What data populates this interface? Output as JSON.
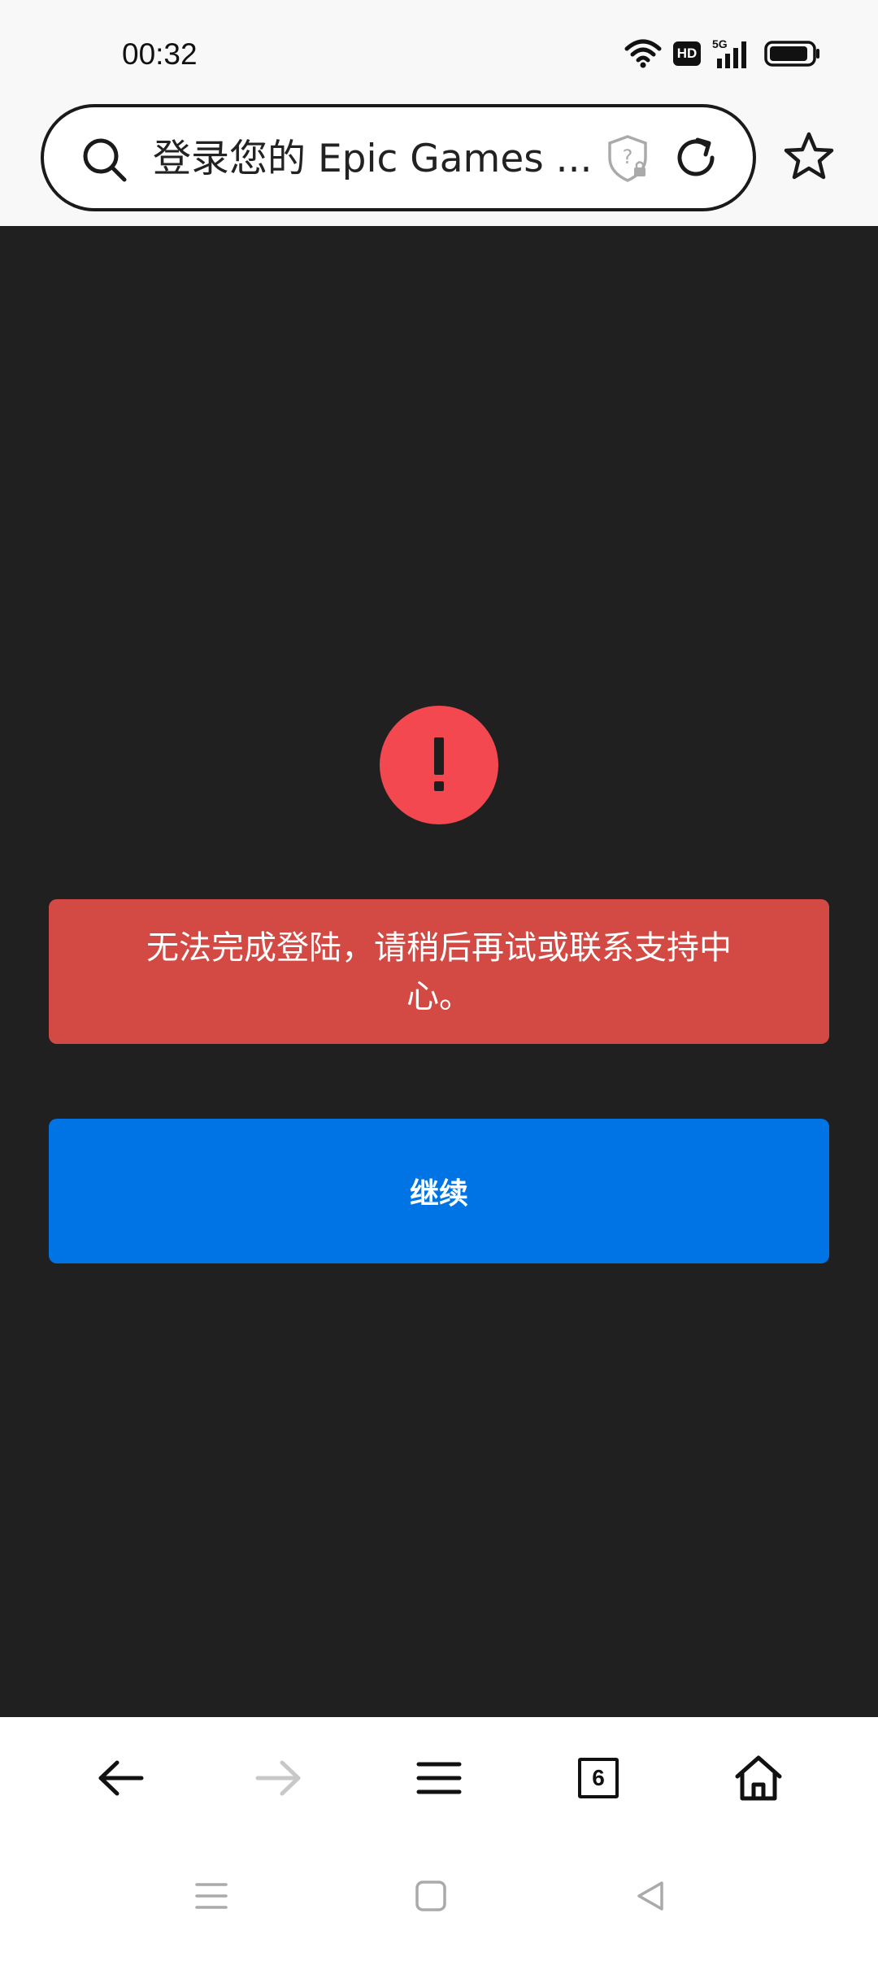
{
  "status_bar": {
    "time": "00:32",
    "network_badge": "HD",
    "network_type": "5G",
    "icons": [
      "wifi-icon",
      "hd-badge",
      "signal-5g-icon",
      "battery-icon"
    ]
  },
  "browser": {
    "url_title": "登录您的 Epic Games ...",
    "icons": [
      "search-icon",
      "shield-lock-icon",
      "reload-icon",
      "star-icon"
    ]
  },
  "page": {
    "error_message": "无法完成登陆，请稍后再试或联系支持中心。",
    "continue_label": "继续",
    "colors": {
      "background": "#202020",
      "alert_icon": "#f44850",
      "error_box": "#d24a43",
      "continue_button": "#0074e4"
    }
  },
  "toolbar": {
    "tab_count": "6",
    "icons": [
      "back-arrow-icon",
      "forward-arrow-icon",
      "menu-icon",
      "tabs-icon",
      "home-icon"
    ]
  },
  "system_nav": {
    "icons": [
      "recents-icon",
      "home-square-icon",
      "back-triangle-icon"
    ]
  }
}
